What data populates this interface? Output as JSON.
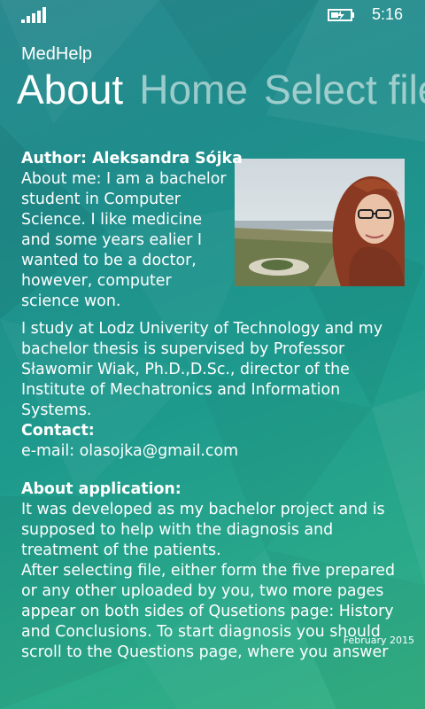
{
  "status": {
    "time": "5:16",
    "signal_icon": "signal-bars-icon",
    "battery_icon": "battery-charging-icon"
  },
  "app": {
    "title": "MedHelp"
  },
  "pivot": {
    "tabs": [
      {
        "label": "About"
      },
      {
        "label": "Home"
      },
      {
        "label": "Select file"
      }
    ]
  },
  "about": {
    "author": "Author: Aleksandra Sójka",
    "about_me": "About me: I am a bachelor student in Computer Science. I like medicine and some years ealier I wanted to be a doctor, however, computer science won.",
    "study": "I study at Lodz Univerity of Technology and my bachelor thesis is supervised by Professor Sławomir Wiak, Ph.D.,D.Sc., director of the Institute of Mechatronics and Information Systems.",
    "contact_heading": "Contact:",
    "email": "e-mail: olasojka@gmail.com",
    "app_heading": "About application:",
    "app_text1": "It was developed as my bachelor project and is supposed to help with the diagnosis and treatment of the patients.",
    "app_text2": "After selecting file, either form the five prepared or any other uploaded by you, two more pages appear on both sides of Qusetions page: History and Conclusions. To start diagnosis you should scroll to the Questions page, where you answer",
    "date": "February 2015"
  }
}
